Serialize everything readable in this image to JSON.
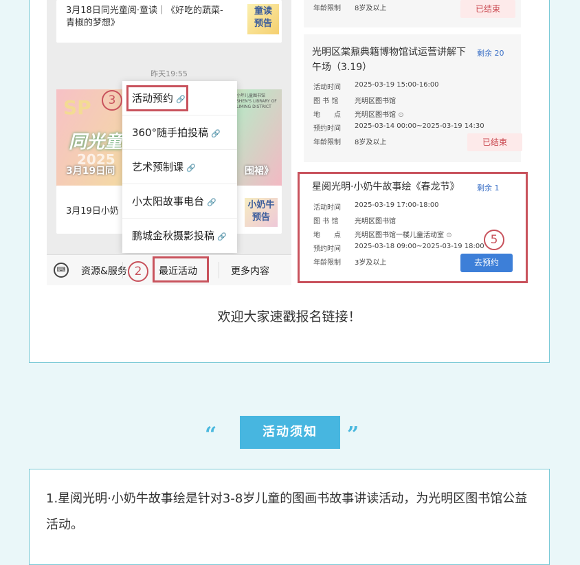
{
  "caption": "欢迎大家速戳报名链接！",
  "left_shot": {
    "top_card": {
      "text_line1": "3月18日同光童阅·童读｜《好吃的蔬菜-",
      "text_line2": "青椒的梦想》",
      "thumb_line1": "童读",
      "thumb_line2": "预告"
    },
    "time": "昨天19:55",
    "banner": {
      "big_text": "同光童",
      "year_text": "2025",
      "caption_left": "3月19日同",
      "caption_right": "围裙》",
      "library_text": "小年儿童图书馆 SHEN'S LIBRARY OF LIMING DISTRICT",
      "sp_text": "SP"
    },
    "second_card": {
      "text": "3月19日小奶",
      "thumb_line1": "小奶牛",
      "thumb_line2": "预告"
    },
    "menu_items": [
      "活动预约",
      "360°随手拍投稿",
      "艺术预制课",
      "小太阳故事电台",
      "鹏城金秋摄影投稿"
    ],
    "menu_link_icon": "link-icon",
    "bottom_bar": {
      "keyboard_icon": "keyboard-icon",
      "item1": "资源&服务",
      "item2": "最近活动",
      "item3": "更多内容"
    },
    "markers": {
      "m2": "2",
      "m3": "3"
    }
  },
  "right_shot": {
    "card_top": {
      "age_label": "年龄限制",
      "age_value": "8岁及以上",
      "status": "已结束"
    },
    "card_mid": {
      "title_line1": "光明区棠鼐典籍博物馆试运营讲解下",
      "title_line2": "午场（3.19）",
      "remaining": "剩余 20",
      "rows": [
        {
          "label": "活动时间",
          "value": "2025-03-19 15:00-16:00"
        },
        {
          "label": "图 书 馆",
          "value": "光明区图书馆"
        },
        {
          "label": "地　　点",
          "value": "光明区图书馆"
        },
        {
          "label": "预约时间",
          "value": "2025-03-14 00:00~2025-03-19 14:30"
        },
        {
          "label": "年龄限制",
          "value": "8岁及以上"
        }
      ],
      "status": "已结束"
    },
    "card_highlight": {
      "title": "星阅光明·小奶牛故事绘《春龙节》",
      "remaining": "剩余 1",
      "rows": [
        {
          "label": "活动时间",
          "value": "2025-03-19 17:00-18:00"
        },
        {
          "label": "图 书 馆",
          "value": "光明区图书馆"
        },
        {
          "label": "地　　点",
          "value": "光明区图书馆一楼儿童活动室"
        },
        {
          "label": "预约时间",
          "value": "2025-03-18 09:00~2025-03-19 18:00"
        },
        {
          "label": "年龄限制",
          "value": "3岁及以上"
        }
      ],
      "button": "去预约",
      "marker": "5"
    },
    "location_icon": "location-pin-icon"
  },
  "notice": {
    "quote_open": "“",
    "quote_close": "”",
    "title": "活动须知",
    "text": "1.星阅光明·小奶牛故事绘是针对3-8岁儿童的图画书故事讲读活动，为光明区图书馆公益活动。"
  },
  "colors": {
    "highlight": "#c8525c",
    "accent_blue": "#47b6e0",
    "card_border": "#79c9d6",
    "page_bg": "#eaf7f9"
  }
}
